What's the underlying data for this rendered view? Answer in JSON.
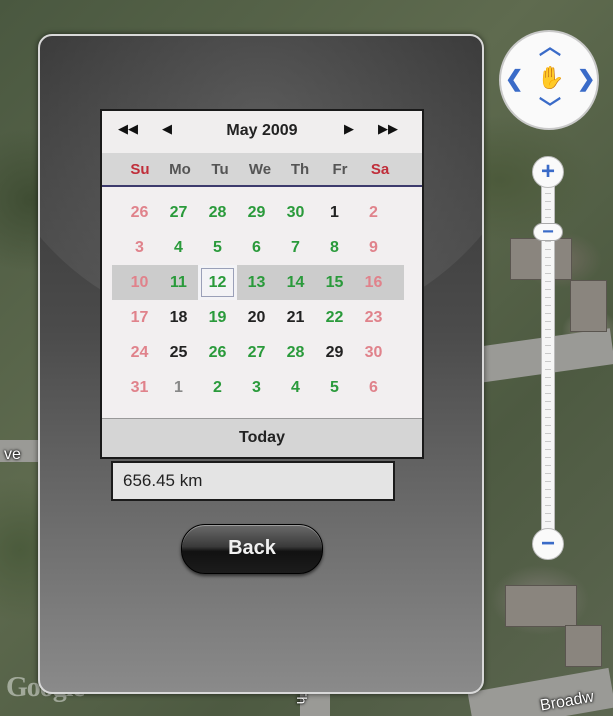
{
  "calendar": {
    "title": "May 2009",
    "nav": {
      "prev_year_icon": "double-left-arrow",
      "prev_month_icon": "left-arrow",
      "next_month_icon": "right-arrow",
      "next_year_icon": "double-right-arrow"
    },
    "weekdays": [
      "Su",
      "Mo",
      "Tu",
      "We",
      "Th",
      "Fr",
      "Sa"
    ],
    "weeks": [
      [
        "26",
        "27",
        "28",
        "29",
        "30",
        "1",
        "2"
      ],
      [
        "3",
        "4",
        "5",
        "6",
        "7",
        "8",
        "9"
      ],
      [
        "10",
        "11",
        "12",
        "13",
        "14",
        "15",
        "16"
      ],
      [
        "17",
        "18",
        "19",
        "20",
        "21",
        "22",
        "23"
      ],
      [
        "24",
        "25",
        "26",
        "27",
        "28",
        "29",
        "30"
      ],
      [
        "31",
        "1",
        "2",
        "3",
        "4",
        "5",
        "6"
      ]
    ],
    "day_colors": [
      [
        "pink",
        "green",
        "green",
        "green",
        "green",
        "black",
        "pink"
      ],
      [
        "pink",
        "green",
        "green",
        "green",
        "green",
        "green",
        "pink"
      ],
      [
        "pink",
        "green",
        "green",
        "green",
        "green",
        "green",
        "pink"
      ],
      [
        "pink",
        "black",
        "green",
        "black",
        "black",
        "green",
        "pink"
      ],
      [
        "pink",
        "black",
        "green",
        "green",
        "green",
        "black",
        "pink"
      ],
      [
        "pink",
        "grey",
        "green",
        "green",
        "green",
        "green",
        "pink"
      ]
    ],
    "selected_week_index": 2,
    "today_cell": {
      "week": 2,
      "day": 2
    },
    "footer_label": "Today"
  },
  "distance_text": "656.45 km",
  "back_label": "Back",
  "map": {
    "labels": [
      "ve",
      "Th",
      "Broadw"
    ],
    "logo": "Google",
    "controls": {
      "pan_icons": [
        "up-arrow",
        "left-arrow",
        "right-arrow",
        "down-arrow",
        "hand"
      ],
      "zoom_in_label": "+",
      "zoom_out_label": "−",
      "zoom_thumb_label": "−"
    }
  },
  "colors": {
    "weekend": "#c02e3a",
    "active_day": "#2a9a3b",
    "inactive_weekend": "#e0828b",
    "other_month": "#888888",
    "control_accent": "#3a6bc8"
  }
}
